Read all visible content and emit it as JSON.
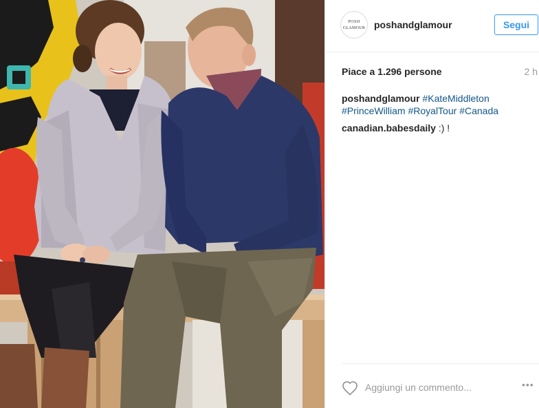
{
  "post": {
    "image_alt": "Kate Middleton and Prince William seated on a wooden bench",
    "username": "poshandglamour",
    "avatar_line1": "POSH",
    "avatar_line2": "GLAMOUR",
    "follow_label": "Segui",
    "likes_text": "Piace a 1.296 persone",
    "time_text": "2 h",
    "caption_user": "poshandglamour",
    "hashtags": [
      "#KateMiddleton",
      "#PrinceWilliam",
      "#RoyalTour",
      "#Canada"
    ],
    "comment_user": "canadian.babesdaily",
    "comment_text": ":) !",
    "comment_placeholder": "Aggiungi un commento...",
    "more_label": "•••"
  },
  "icons": {
    "heart": "heart-outline-icon",
    "more": "more-options-icon"
  },
  "colors": {
    "link_blue": "#3897f0",
    "hashtag_blue": "#125688",
    "text_dark": "#262626",
    "text_grey": "#999999"
  }
}
